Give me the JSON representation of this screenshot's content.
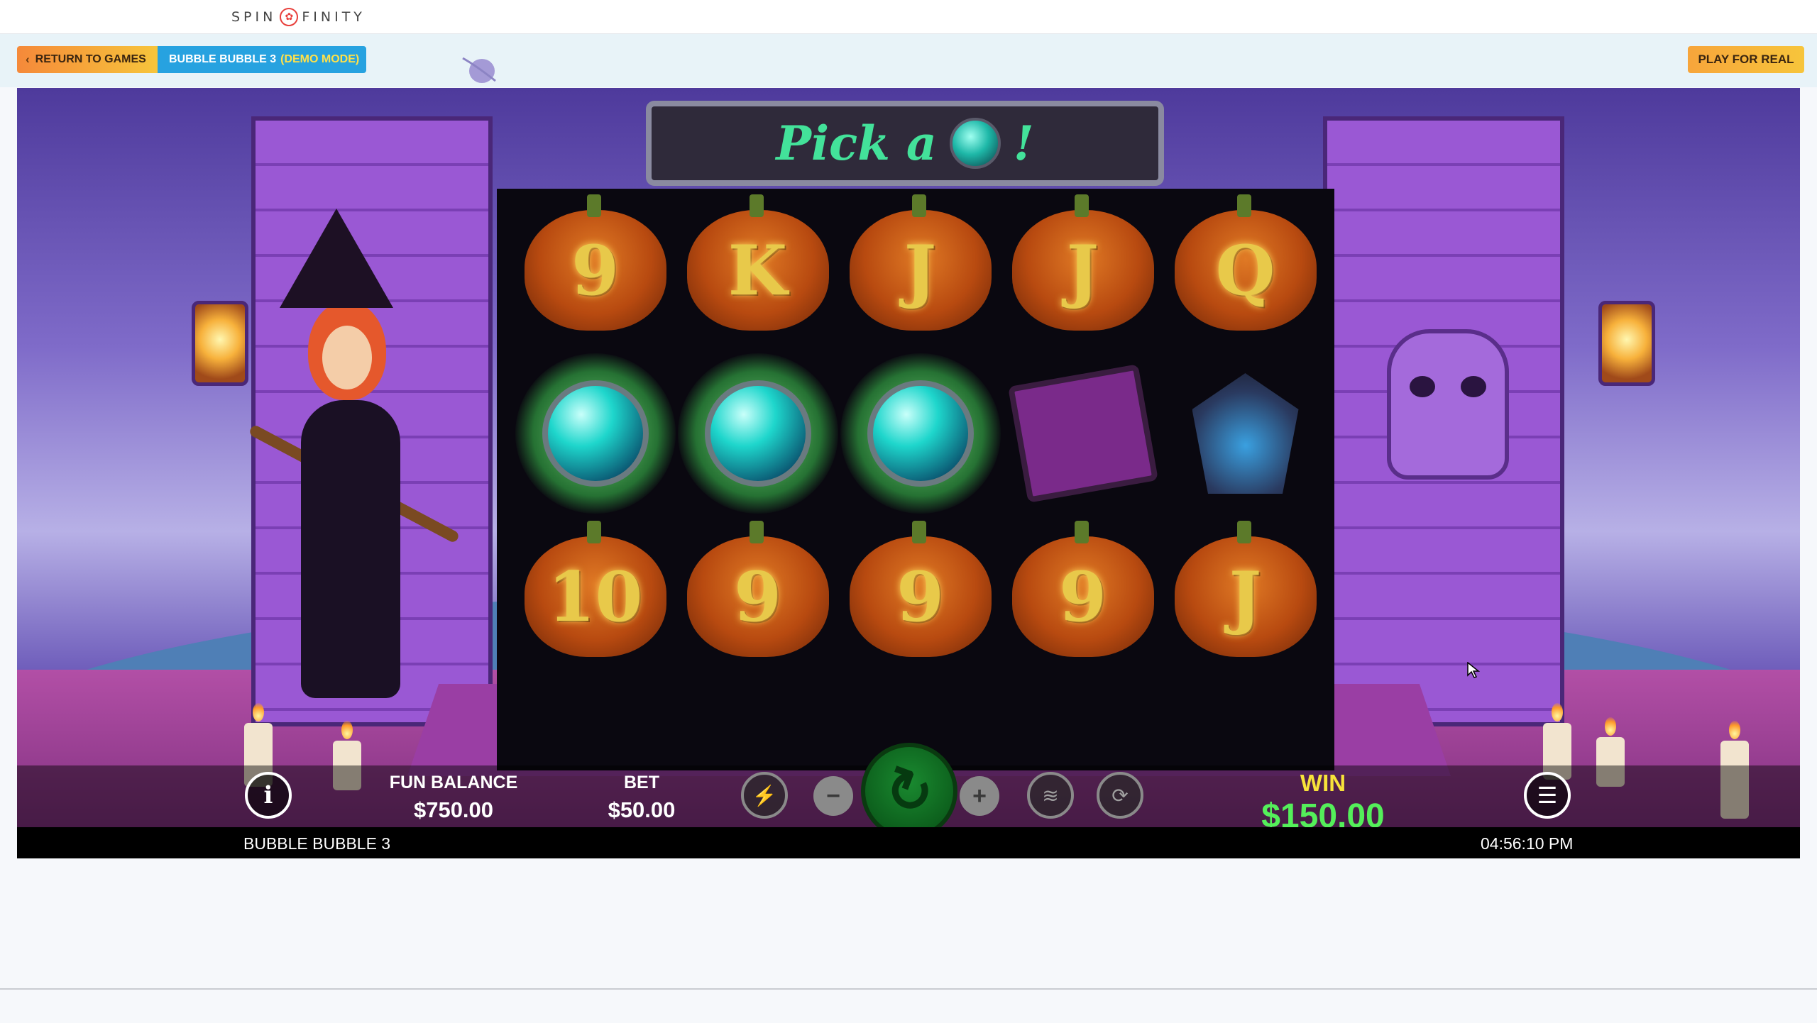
{
  "header": {
    "logo_left": "SPIN",
    "logo_mark": "✿",
    "logo_right": "FINITY"
  },
  "subbar": {
    "return_label": "RETURN TO GAMES",
    "game_label": "BUBBLE BUBBLE 3",
    "demo_label": "(DEMO MODE)",
    "play_real_label": "PLAY FOR REAL"
  },
  "game": {
    "banner": {
      "text": "Pick a",
      "exclaim": "!"
    },
    "reels": [
      [
        "9",
        "K",
        "J",
        "J",
        "Q"
      ],
      [
        "orb",
        "orb",
        "orb",
        "book",
        "bat-gem"
      ],
      [
        "10",
        "9",
        "9",
        "9",
        "J"
      ]
    ],
    "reel_symbols": {
      "r0c0": "9",
      "r0c1": "K",
      "r0c2": "J",
      "r0c3": "J",
      "r0c4": "Q",
      "r2c0": "10",
      "r2c1": "9",
      "r2c2": "9",
      "r2c3": "9",
      "r2c4": "J"
    },
    "controls": {
      "info_icon": "i",
      "balance_label": "FUN BALANCE",
      "balance_value": "$750.00",
      "bet_label": "BET",
      "bet_value": "$50.00",
      "bolt_icon": "⚡",
      "minus_icon": "−",
      "spin_icon": "↻",
      "plus_icon": "+",
      "coins_icon": "≋",
      "autoplay_icon": "⟳",
      "win_label": "WIN",
      "win_value": "$150.00",
      "menu_icon": "☰"
    },
    "footer": {
      "game_name": "BUBBLE BUBBLE 3",
      "time": "04:56:10 PM"
    }
  },
  "colors": {
    "return_gradient_start": "#f5893a",
    "return_gradient_end": "#f7c53b",
    "game_tag": "#27a2e0",
    "demo_text": "#ffe14a",
    "win_label": "#f7e23a",
    "win_value": "#54ef5a",
    "banner_text": "#43e29a"
  }
}
